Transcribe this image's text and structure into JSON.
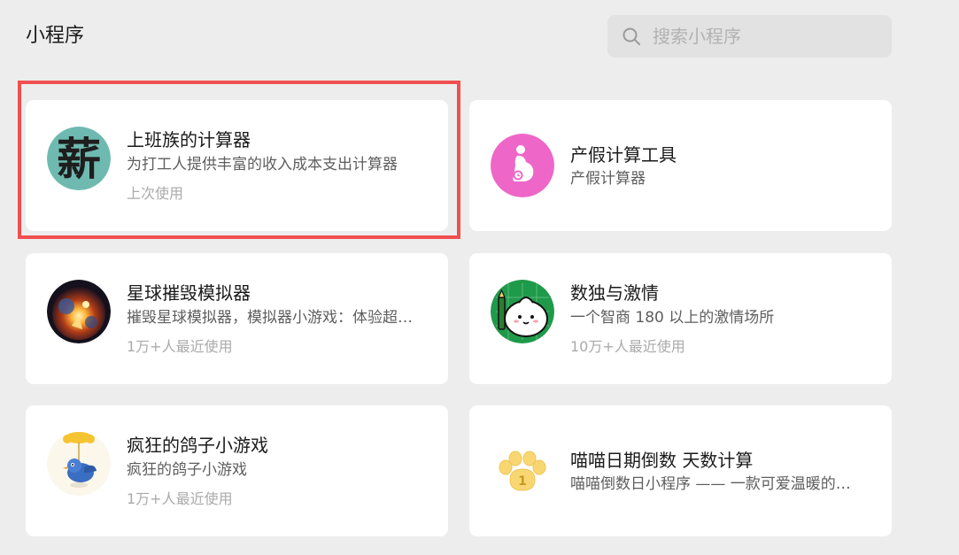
{
  "page": {
    "title": "小程序"
  },
  "search": {
    "placeholder": "搜索小程序",
    "icon": "search-icon"
  },
  "colors": {
    "background": "#ededed",
    "card": "#ffffff",
    "selection_border": "#f0504f"
  },
  "apps": [
    {
      "name": "上班族的计算器",
      "desc": "为打工人提供丰富的收入成本支出计算器",
      "meta": "上次使用",
      "icon": "salary-calculator-icon",
      "icon_glyph": "薪",
      "selected": true
    },
    {
      "name": "产假计算工具",
      "desc": "产假计算器",
      "meta": "",
      "icon": "maternity-leave-icon"
    },
    {
      "name": "星球摧毁模拟器",
      "desc": "摧毁星球模拟器，模拟器小游戏：体验超…",
      "meta": "1万+人最近使用",
      "icon": "planet-explosion-icon"
    },
    {
      "name": "数独与激情",
      "desc": "一个智商 180 以上的激情场所",
      "meta": "10万+人最近使用",
      "icon": "sudoku-bun-icon"
    },
    {
      "name": "疯狂的鸽子小游戏",
      "desc": "疯狂的鸽子小游戏",
      "meta": "1万+人最近使用",
      "icon": "pigeon-game-icon"
    },
    {
      "name": "喵喵日期倒数 天数计算",
      "desc": "喵喵倒数日小程序 —— 一款可爱温暖的…",
      "meta": "",
      "icon": "cat-paw-icon",
      "icon_glyph": "1"
    }
  ]
}
